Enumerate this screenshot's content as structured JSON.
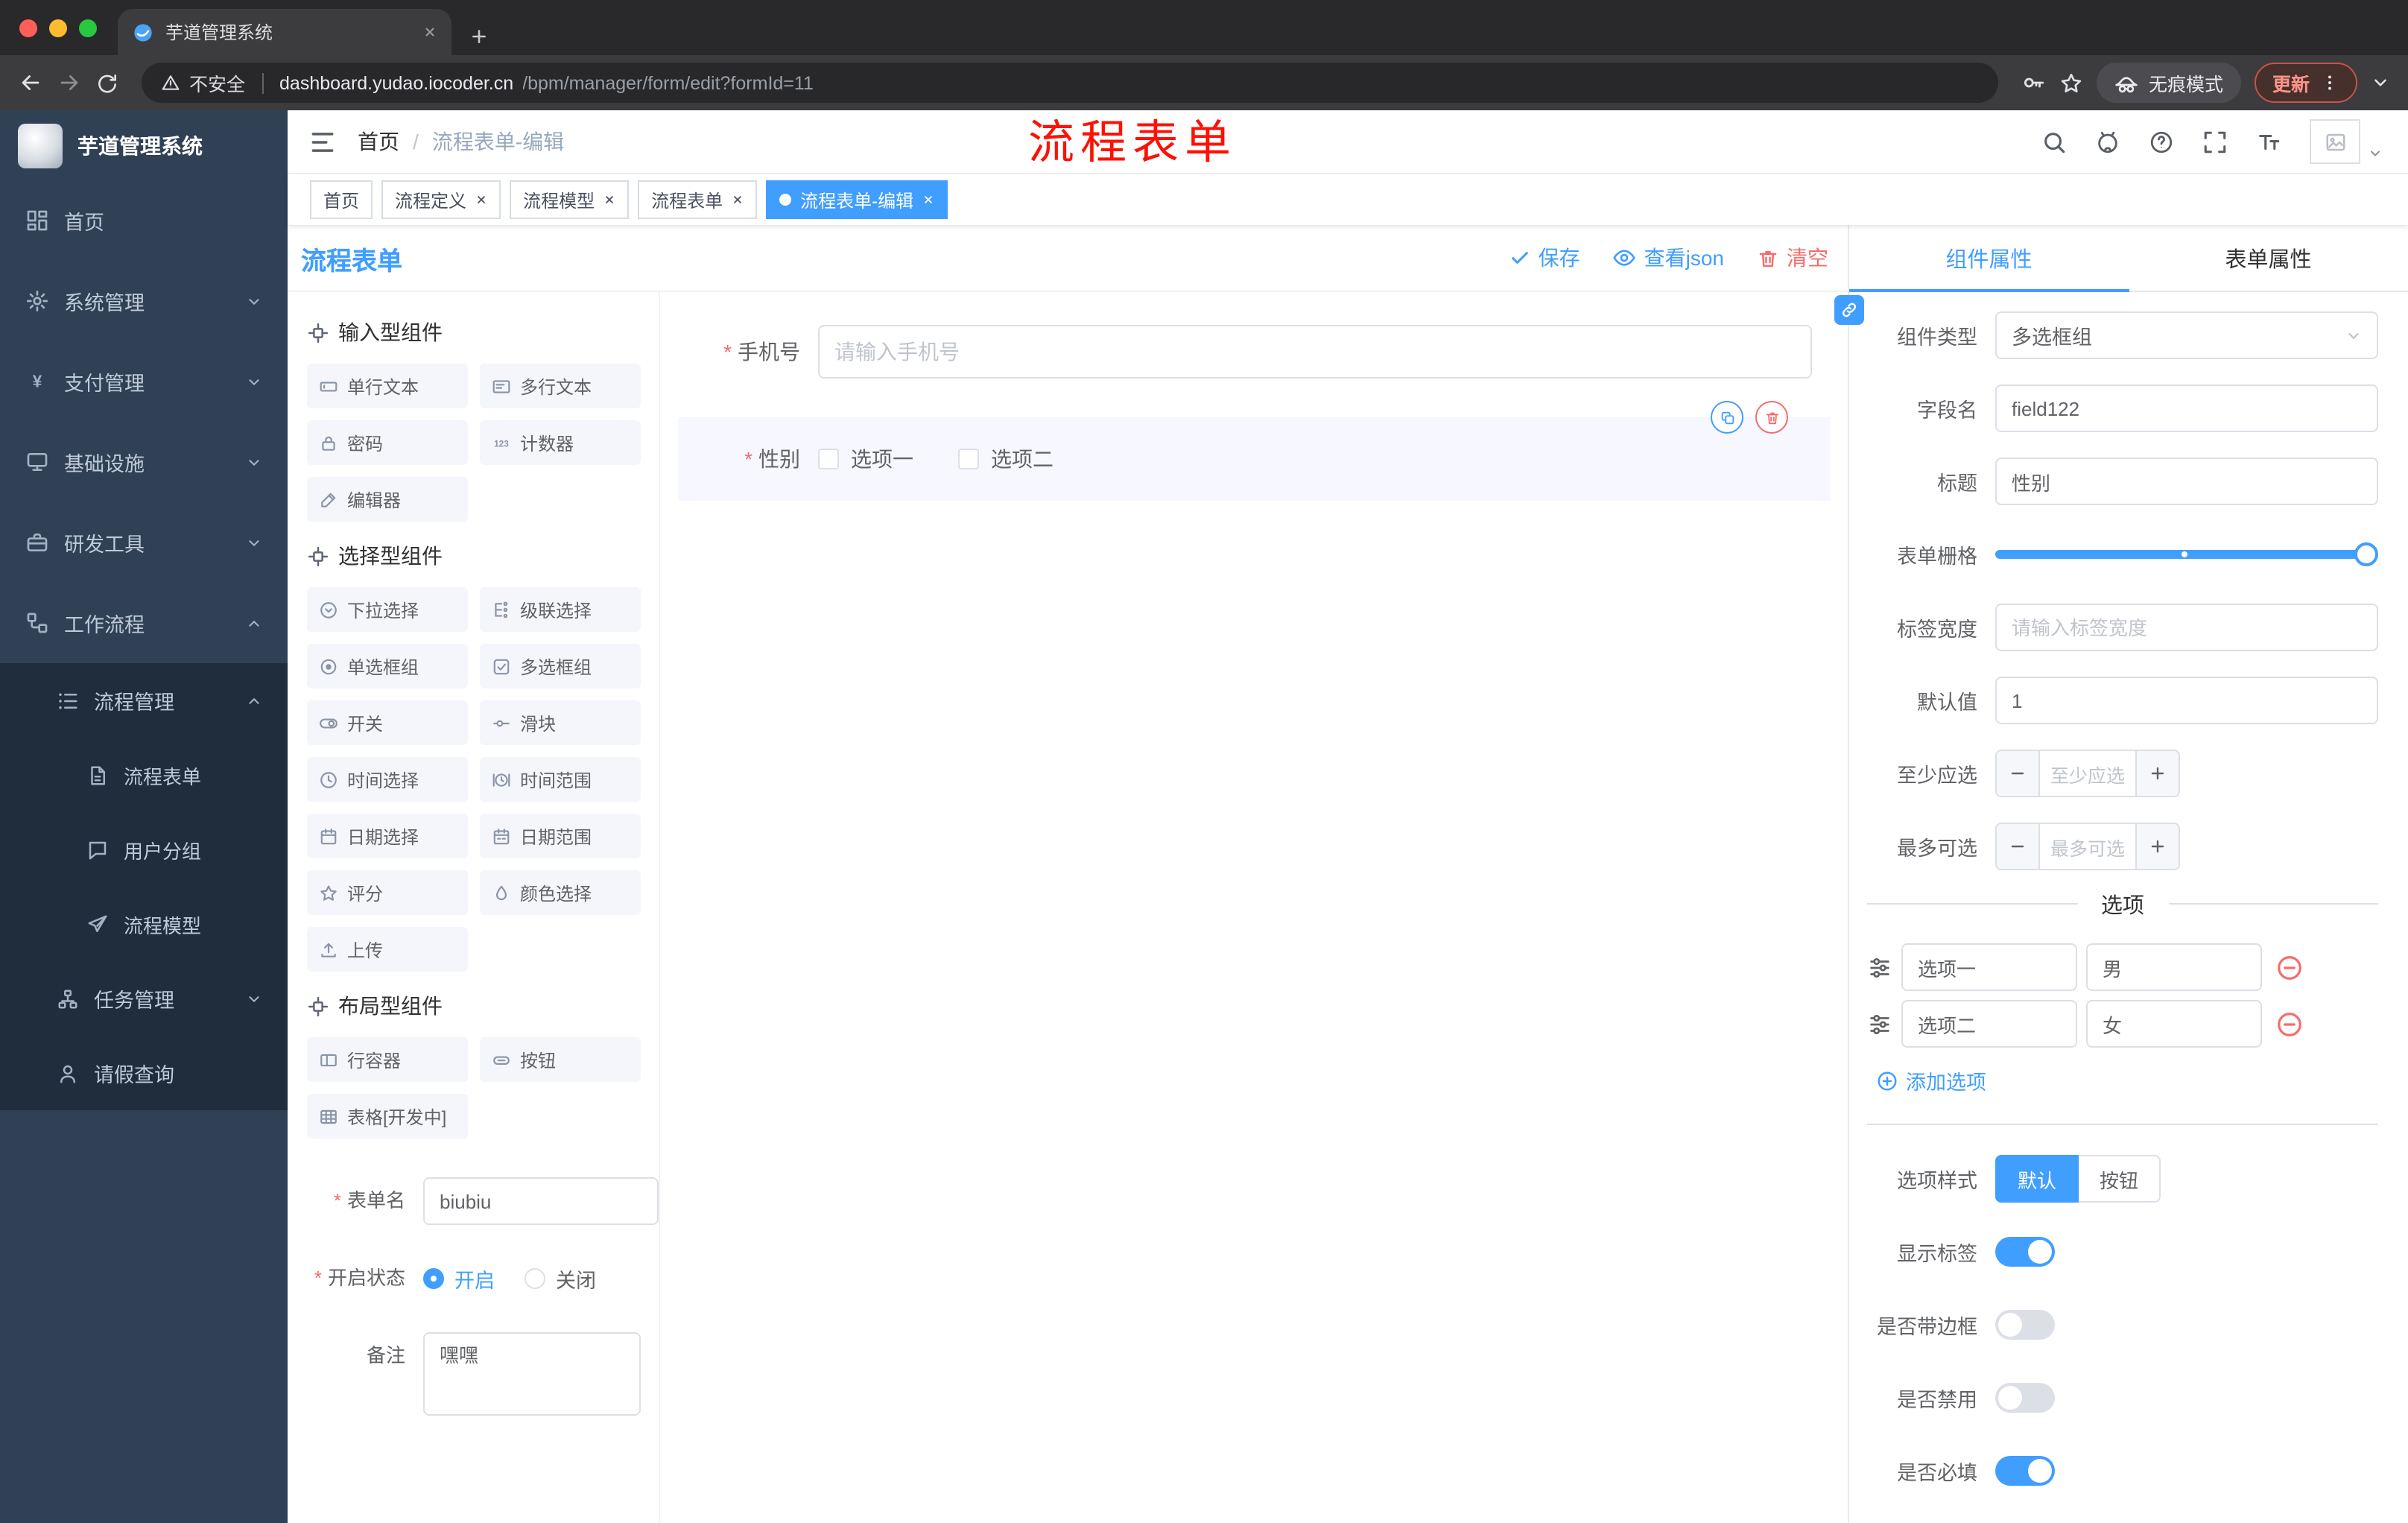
{
  "browser": {
    "tab_title": "芋道管理系统",
    "security_label": "不安全",
    "url_host": "dashboard.yudao.iocoder.cn",
    "url_path": "/bpm/manager/form/edit?formId=11",
    "incognito_label": "无痕模式",
    "update_label": "更新"
  },
  "sidebar": {
    "logo_title": "芋道管理系统",
    "items": [
      "首页",
      "系统管理",
      "支付管理",
      "基础设施",
      "研发工具",
      "工作流程",
      "流程管理",
      "流程表单",
      "用户分组",
      "流程模型",
      "任务管理",
      "请假查询"
    ]
  },
  "navbar": {
    "breadcrumb": {
      "home": "首页",
      "separator": "/",
      "current": "流程表单-编辑"
    },
    "annotation": "流程表单"
  },
  "tags": [
    "首页",
    "流程定义",
    "流程模型",
    "流程表单",
    "流程表单-编辑"
  ],
  "designer": {
    "title": "流程表单",
    "save_label": "保存",
    "view_json_label": "查看json",
    "clear_label": "清空",
    "groups": {
      "input": {
        "title": "输入型组件",
        "items": [
          "单行文本",
          "多行文本",
          "密码",
          "计数器",
          "编辑器"
        ]
      },
      "select": {
        "title": "选择型组件",
        "items": [
          "下拉选择",
          "级联选择",
          "单选框组",
          "多选框组",
          "开关",
          "滑块",
          "时间选择",
          "时间范围",
          "日期选择",
          "日期范围",
          "评分",
          "颜色选择",
          "上传"
        ]
      },
      "layout": {
        "title": "布局型组件",
        "items": [
          "行容器",
          "按钮",
          "表格[开发中]"
        ]
      }
    },
    "meta": {
      "form_name_label": "表单名",
      "form_name_value": "biubiu",
      "status_label": "开启状态",
      "status_on": "开启",
      "status_off": "关闭",
      "status_value": "开启",
      "remark_label": "备注",
      "remark_value": "嘿嘿"
    },
    "canvas": {
      "phone_label": "手机号",
      "phone_placeholder": "请输入手机号",
      "gender_label": "性别",
      "gender_option1": "选项一",
      "gender_option2": "选项二"
    }
  },
  "props": {
    "tab_component": "组件属性",
    "tab_form": "表单属性",
    "active_tab": "组件属性",
    "component_type_label": "组件类型",
    "component_type_value": "多选框组",
    "field_name_label": "字段名",
    "field_name_value": "field122",
    "title_label": "标题",
    "title_value": "性别",
    "grid_label": "表单栅格",
    "grid_value_percent": 100,
    "label_width_label": "标签宽度",
    "label_width_placeholder": "请输入标签宽度",
    "default_label": "默认值",
    "default_value": "1",
    "min_label": "至少应选",
    "min_placeholder": "至少应选",
    "max_label": "最多可选",
    "max_placeholder": "最多可选",
    "options_title": "选项",
    "options": [
      {
        "label": "选项一",
        "value": "男"
      },
      {
        "label": "选项二",
        "value": "女"
      }
    ],
    "add_option_label": "添加选项",
    "option_style_label": "选项样式",
    "style_default": "默认",
    "style_button": "按钮",
    "style_value": "默认",
    "toggles": [
      {
        "label": "显示标签",
        "on": true
      },
      {
        "label": "是否带边框",
        "on": false
      },
      {
        "label": "是否禁用",
        "on": false
      },
      {
        "label": "是否必填",
        "on": true
      }
    ]
  },
  "colors": {
    "accent": "#409EFF",
    "danger": "#F56C6C",
    "sidebar_bg": "#304156",
    "submenu_bg": "#1F2D3D"
  }
}
